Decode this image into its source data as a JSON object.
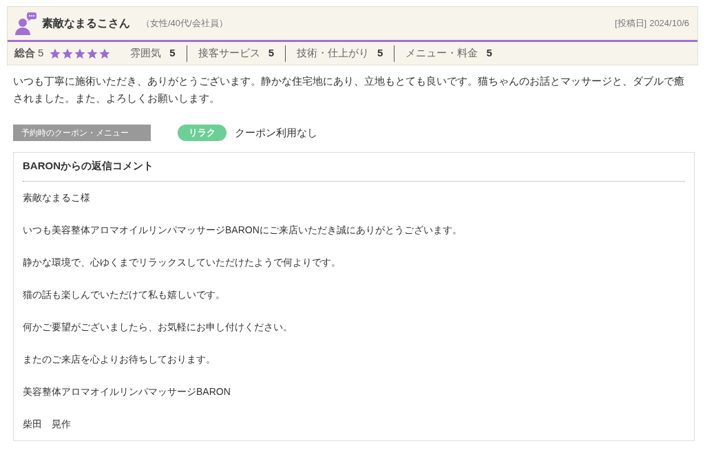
{
  "reviewer": {
    "name": "素敵なまるこさん",
    "profile": "（女性/40代/会社員）",
    "posted_label": "[投稿日]",
    "posted_date": "2024/10/6"
  },
  "overall": {
    "label": "総合",
    "score": "5",
    "stars": 5
  },
  "ratings": [
    {
      "label": "雰囲気",
      "score": "5"
    },
    {
      "label": "接客サービス",
      "score": "5"
    },
    {
      "label": "技術・仕上がり",
      "score": "5"
    },
    {
      "label": "メニュー・料金",
      "score": "5"
    }
  ],
  "review_text": "いつも丁寧に施術いただき、ありがとうございます。静かな住宅地にあり、立地もとても良いです。猫ちゃんのお話とマッサージと、ダブルで癒されました。また、よろしくお願いします。",
  "coupon": {
    "label": "予約時のクーポン・メニュー",
    "tag": "リラク",
    "value": "クーポン利用なし"
  },
  "reply": {
    "title": "BARONからの返信コメント",
    "paragraphs": [
      "素敵なまるこ様",
      "いつも美容整体アロマオイルリンパマッサージBARONにご来店いただき誠にありがとうございます。",
      "静かな環境で、心ゆくまでリラックスしていただけたようで何よりです。",
      "猫の話も楽しんでいただけて私も嬉しいです。",
      "何かご要望がございましたら、お気軽にお申し付けください。",
      "またのご来店を心よりお待ちしております。",
      "美容整体アロマオイルリンパマッサージBARON",
      "柴田　晃作"
    ]
  }
}
